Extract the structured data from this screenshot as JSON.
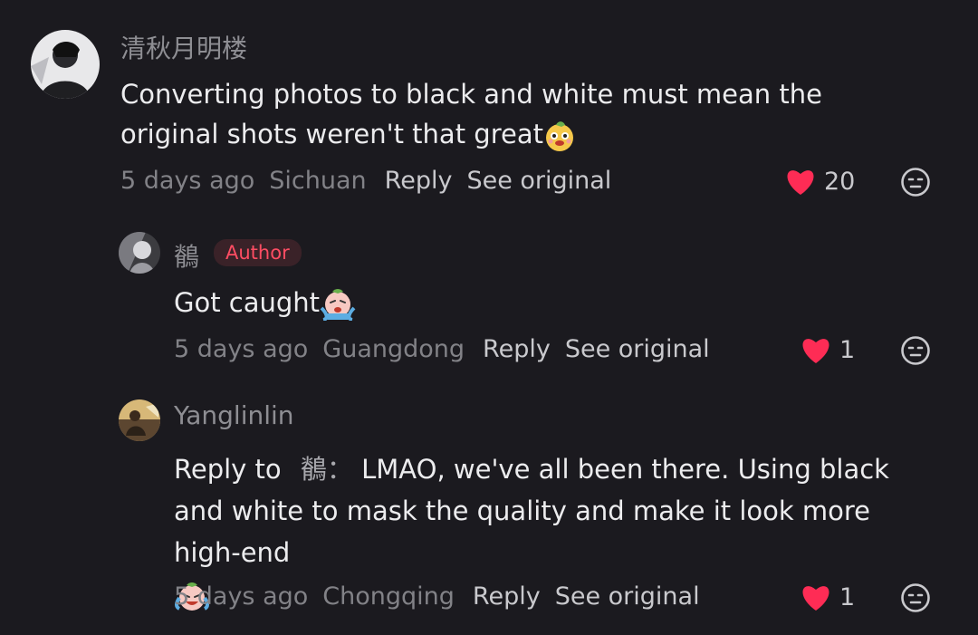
{
  "comments": [
    {
      "username": "清秋月明楼",
      "text": "Converting photos to black and white must mean the original shots weren't that great",
      "emoji": "smirking-face-emoji",
      "time": "5 days ago",
      "location": "Sichuan",
      "reply_label": "Reply",
      "see_original_label": "See original",
      "likes": "20"
    },
    {
      "username": "鶺",
      "badge": "Author",
      "text": "Got caught",
      "emoji": "crying-face-emoji",
      "time": "5 days ago",
      "location": "Guangdong",
      "reply_label": "Reply",
      "see_original_label": "See original",
      "likes": "1"
    },
    {
      "username": "Yanglinlin",
      "reply_prefix": "Reply to",
      "reply_target": "鶺：",
      "text": "LMAO, we've all been there. Using black and white to mask the quality and make it look more high-end",
      "emoji": "crying-laughing-face-emoji",
      "time": "5 days ago",
      "location": "Chongqing",
      "reply_label": "Reply",
      "see_original_label": "See original",
      "likes": "1"
    }
  ],
  "colors": {
    "background": "#1b1a1f",
    "heart": "#fe2c55",
    "badge_text": "#ff4d63",
    "muted": "#828287"
  }
}
